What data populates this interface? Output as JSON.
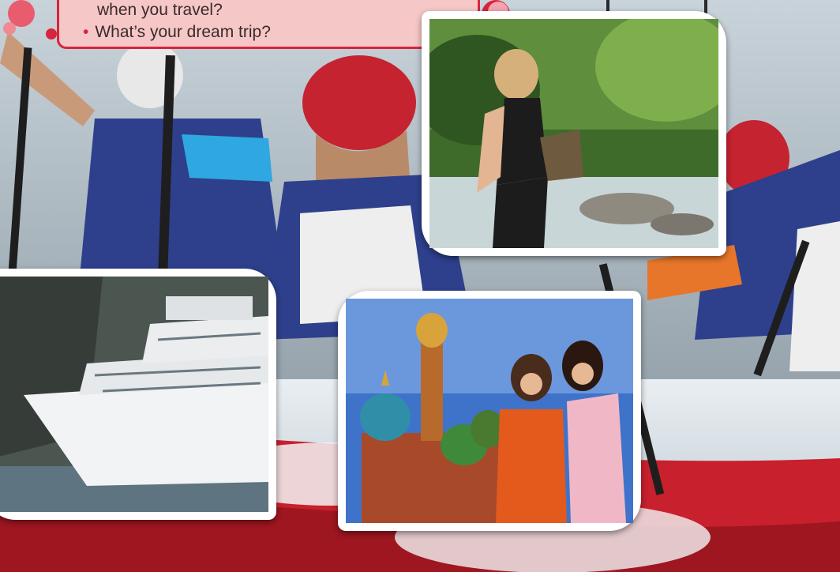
{
  "bubble": {
    "line1": "when you travel?",
    "line2": "What’s your dream trip?"
  },
  "photos": [
    {
      "name": "photo-hiker",
      "subject": "woman hiking by a river"
    },
    {
      "name": "photo-cruise-ship",
      "subject": "cruise ship near cliffs"
    },
    {
      "name": "photo-moscow",
      "subject": "two women in front of St. Basil's Cathedral"
    }
  ],
  "colors": {
    "accent": "#d8243b",
    "bubble": "#f6c7c7",
    "raft": "#c8202c",
    "lifevest": "#2e3f8c"
  }
}
